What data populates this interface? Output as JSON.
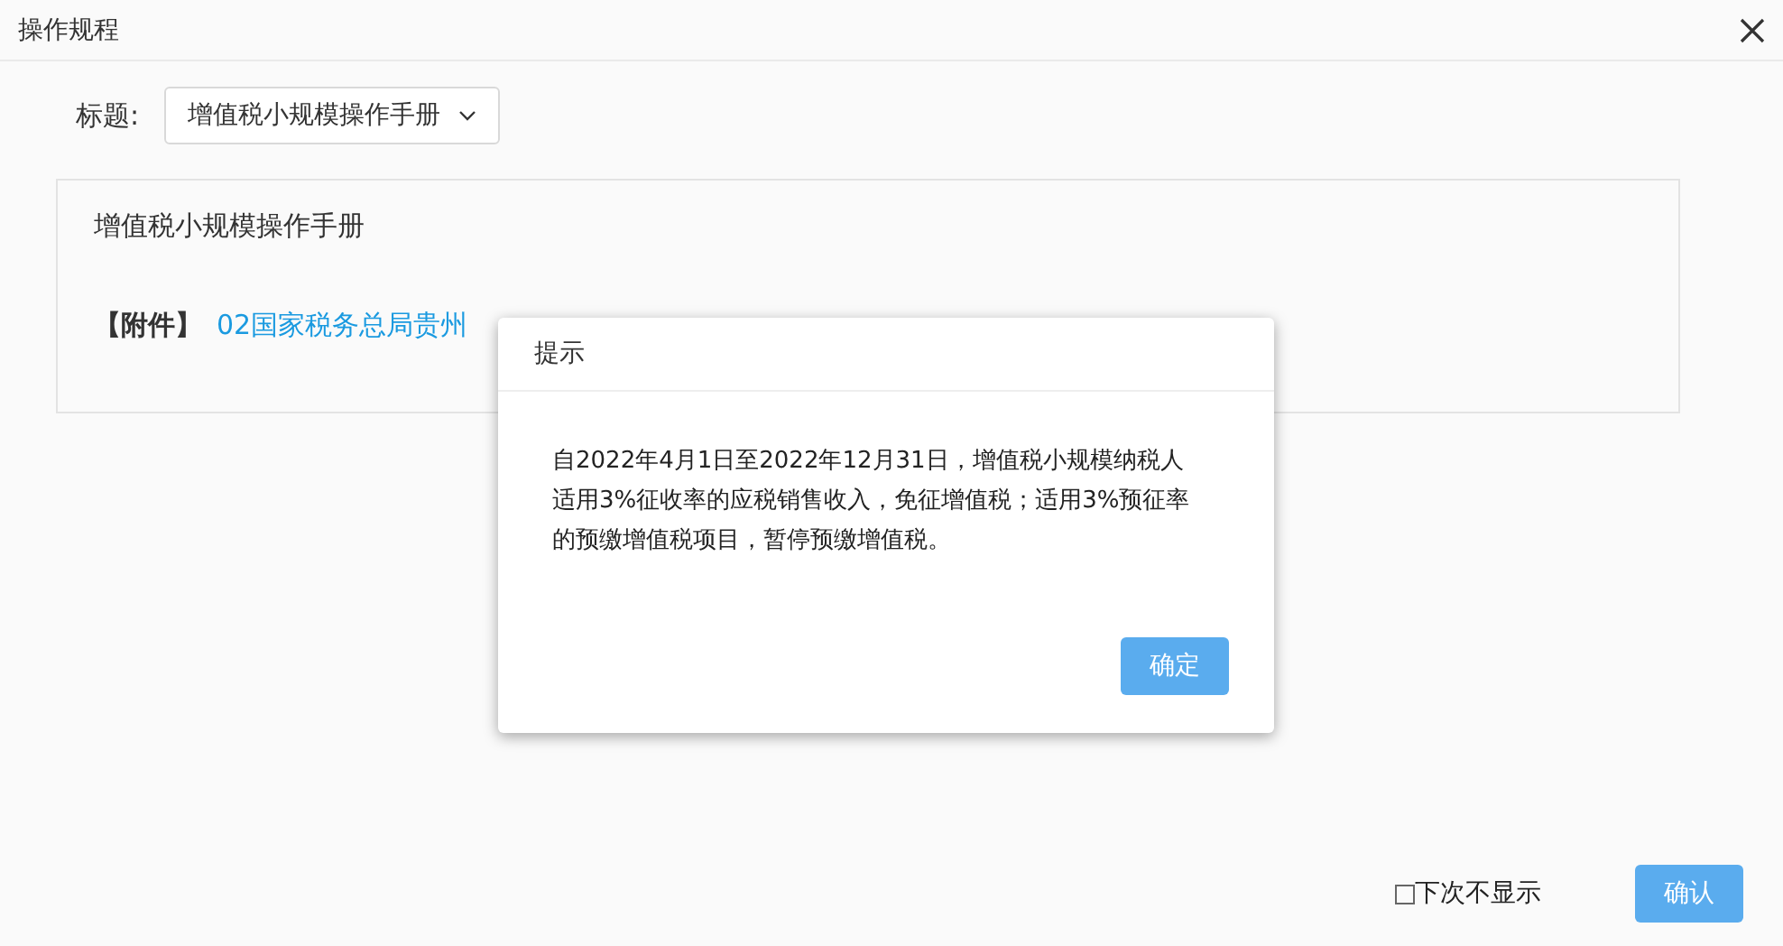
{
  "window": {
    "title": "操作规程"
  },
  "title_field": {
    "label": "标题:",
    "value": "增值税小规模操作手册"
  },
  "document": {
    "title": "增值税小规模操作手册",
    "attachment_label": "【附件】",
    "attachment_link": "02国家税务总局贵州"
  },
  "footer": {
    "dont_show_again": {
      "label": "下次不显示",
      "checked": false
    },
    "confirm_button": "确认"
  },
  "dialog": {
    "title": "提示",
    "message": "自2022年4月1日至2022年12月31日，增值税小规模纳税人适用3%征收率的应税销售收入，免征增值税；适用3%预征率的预缴增值税项目，暂停预缴增值税。",
    "ok_button": "确定"
  }
}
